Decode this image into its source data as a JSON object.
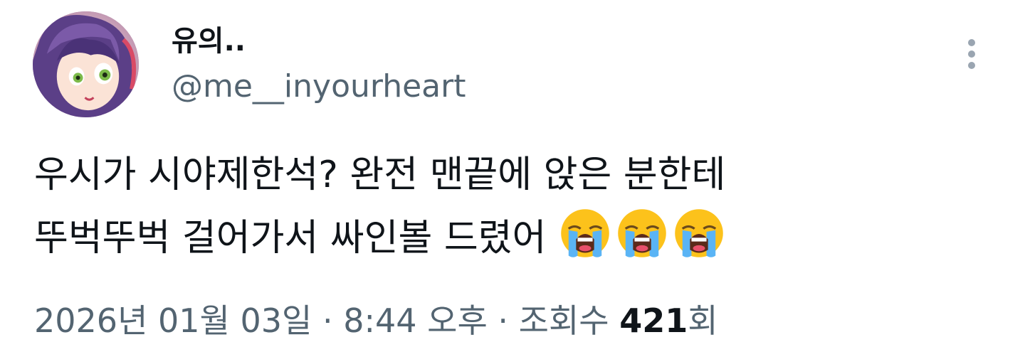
{
  "tweet": {
    "author": {
      "display_name": "유의..",
      "handle": "@me__inyourheart",
      "avatar": "anime-character-avatar"
    },
    "more_icon": "vertical-ellipsis-icon",
    "text_lines": [
      "우시가 시야제한석? 완전 맨끝에 앉은 분한테",
      "뚜벅뚜벅 걸어가서 싸인볼 드렸어"
    ],
    "emojis": [
      "loudly-crying-face",
      "loudly-crying-face",
      "loudly-crying-face"
    ],
    "date": "2026년 01월 03일",
    "separator": "·",
    "time": "8:44 오후",
    "views_label": "조회수",
    "views_count": "421",
    "views_suffix": "회"
  },
  "colors": {
    "text_primary": "#0f1419",
    "text_secondary": "#536471",
    "background": "#ffffff"
  }
}
